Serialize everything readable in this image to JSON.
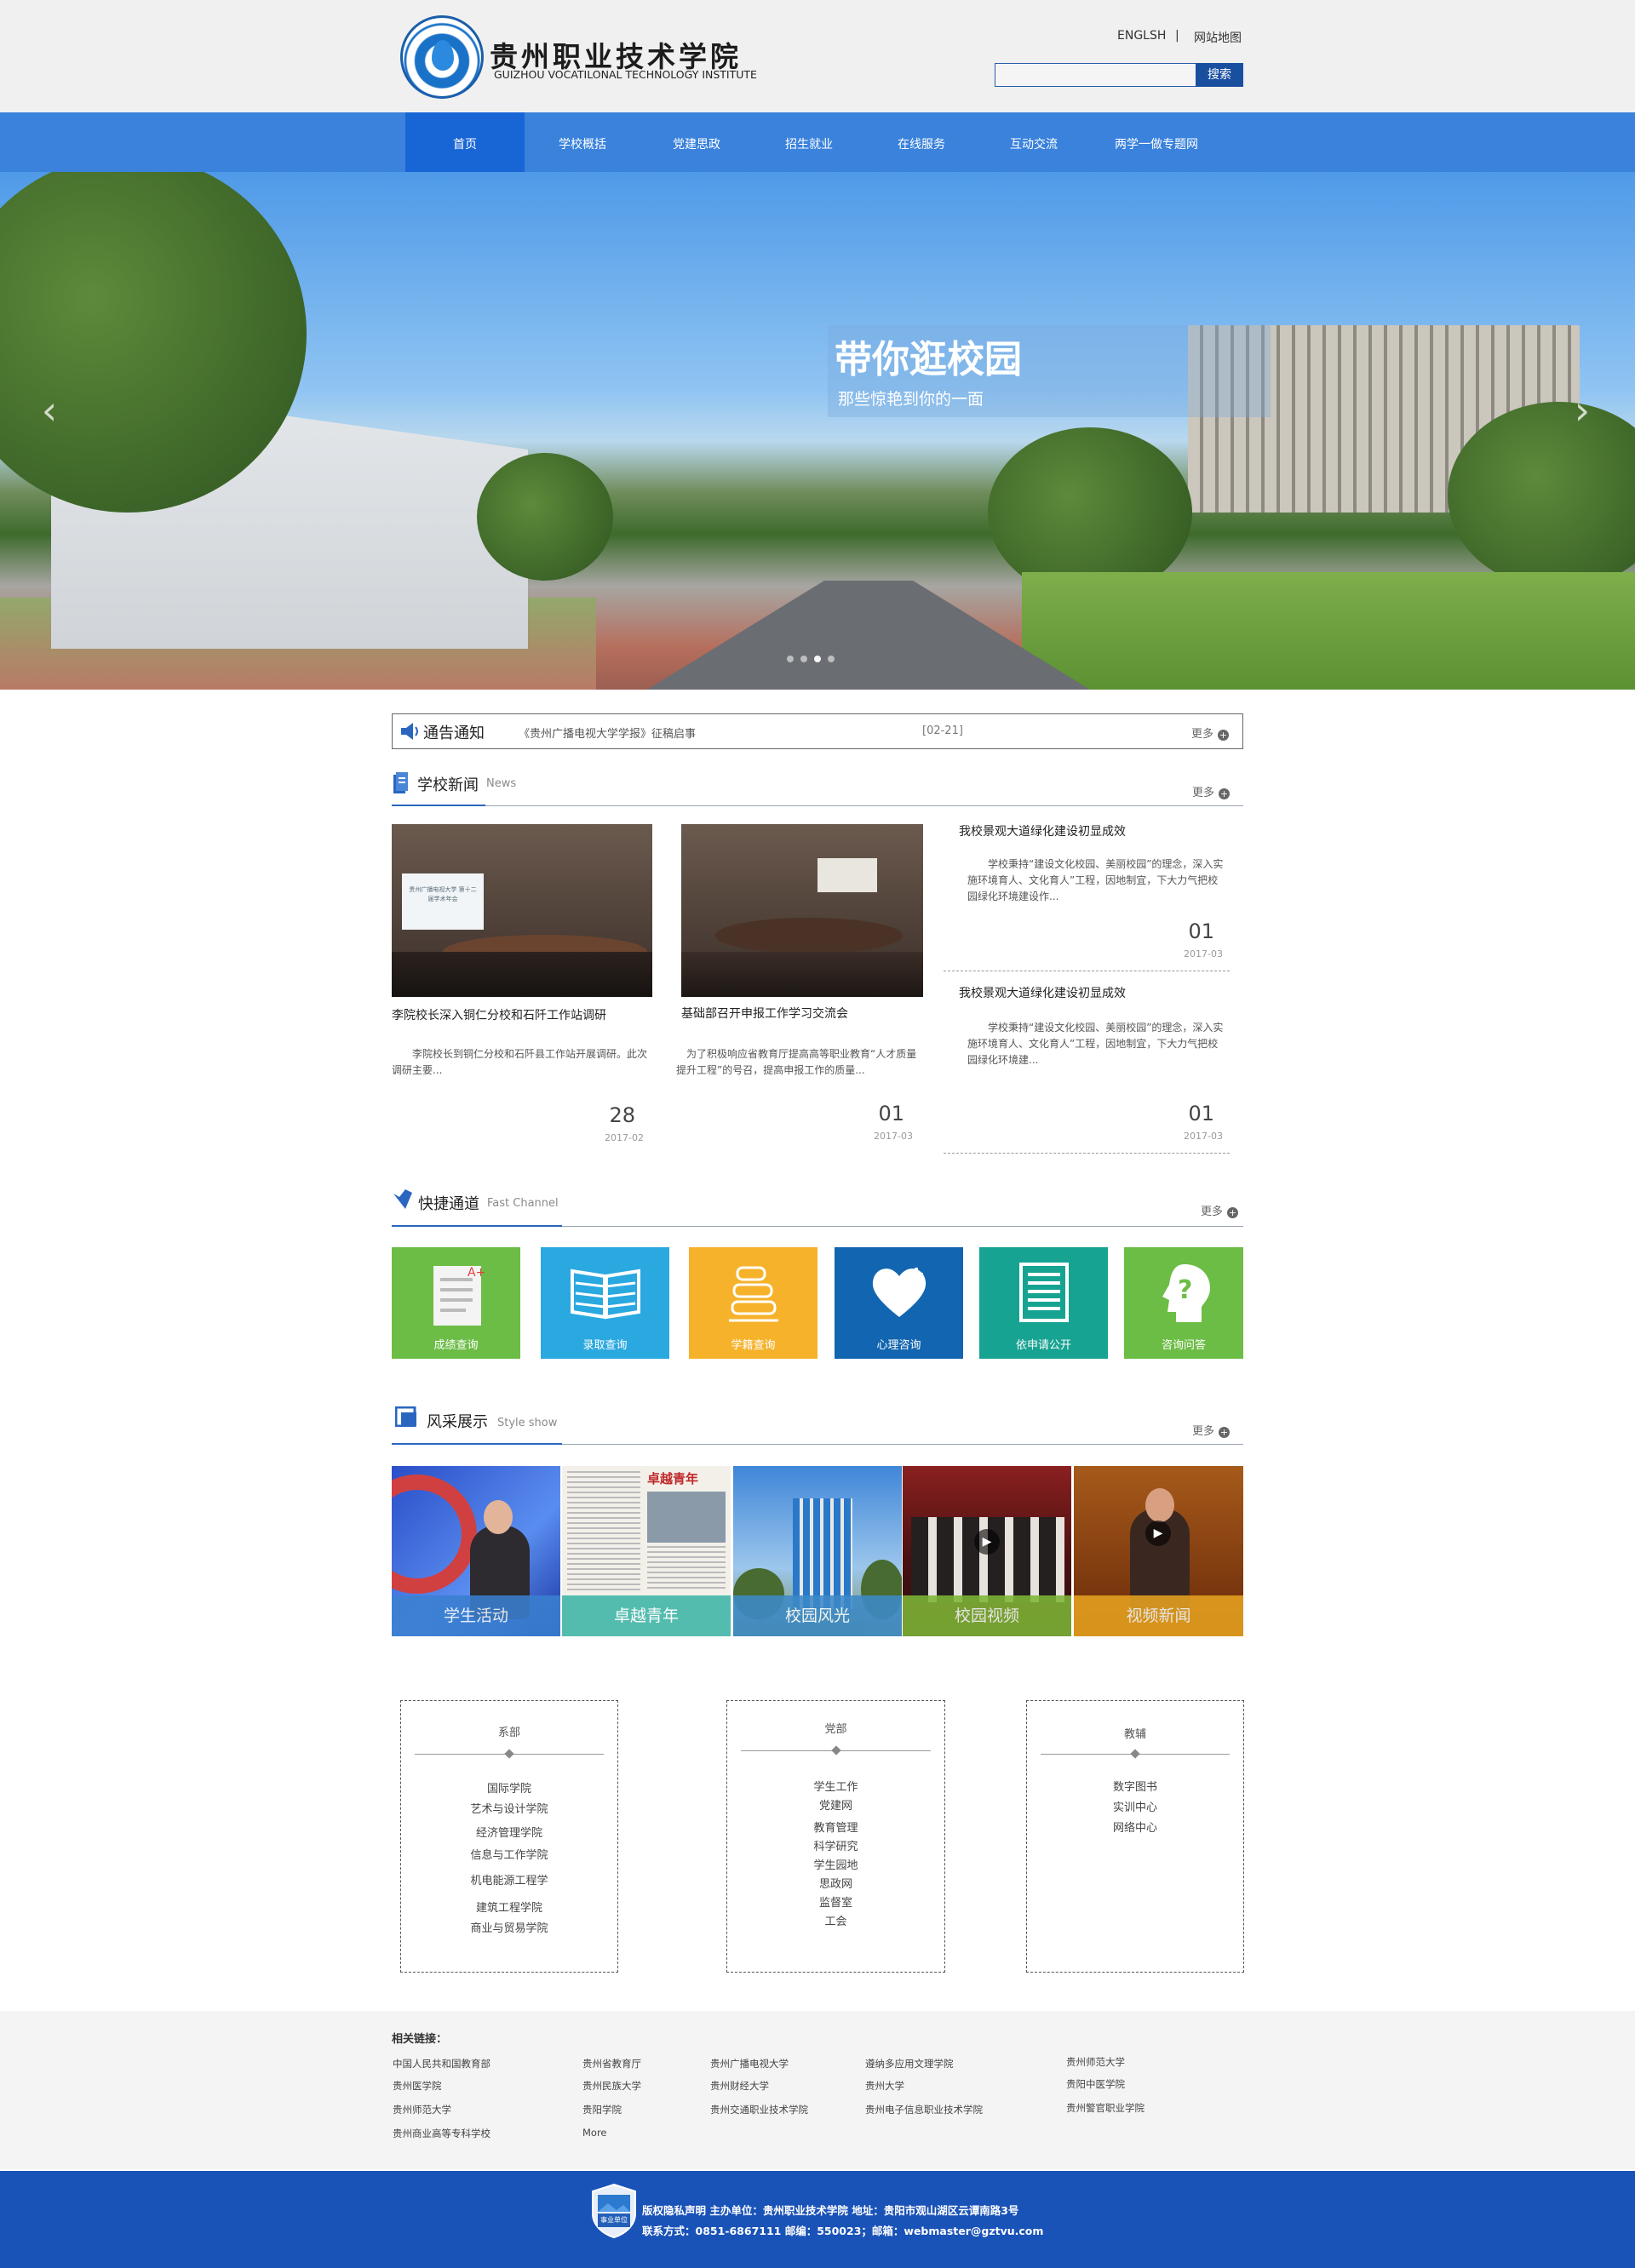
{
  "header": {
    "school_name": "贵州职业技术学院",
    "school_name_en": "GUIZHOU VOCATILONAL TECHNOLOGY INSTITUTE",
    "link_english": "ENGLSH",
    "separator": "|",
    "link_sitemap": "网站地图",
    "search_placeholder": "",
    "search_button": "搜索"
  },
  "nav": {
    "items": [
      "首页",
      "学校概括",
      "党建思政",
      "招生就业",
      "在线服务",
      "互动交流",
      "两学一做专题网"
    ],
    "active_index": 0
  },
  "banner": {
    "title": "带你逛校园",
    "subtitle": "那些惊艳到你的一面",
    "slide_count": 4,
    "active_slide": 2
  },
  "notice": {
    "heading": "通告通知",
    "item_title": "《贵州广播电视大学学报》征稿启事",
    "item_date": "[02-21]",
    "more": "更多"
  },
  "news": {
    "heading": "学校新闻",
    "heading_en": "News",
    "more": "更多",
    "featured": [
      {
        "title": "李院校长深入铜仁分校和石阡工作站调研",
        "summary": "李院校长到铜仁分校和石阡县工作站开展调研。此次调研主要...",
        "day": "28",
        "date": "2017-02",
        "image_screen_text": "贵州广播电视大学 第十二届学术年会"
      },
      {
        "title": "基础部召开申报工作学习交流会",
        "summary": "为了积极响应省教育厅提高高等职业教育“人才质量提升工程”的号召，提高申报工作的质量...",
        "day": "01",
        "date": "2017-03"
      }
    ],
    "side": [
      {
        "title": "我校景观大道绿化建设初显成效",
        "summary": "学校秉持“建设文化校园、美丽校园”的理念，深入实施环境育人、文化育人”工程，因地制宜，下大力气把校园绿化环境建设作...",
        "day": "01",
        "date": "2017-03"
      },
      {
        "title": "我校景观大道绿化建设初显成效",
        "summary": "学校秉持“建设文化校园、美丽校园”的理念，深入实施环境育人、文化育人”工程，因地制宜，下大力气把校园绿化环境建...",
        "day": "01",
        "date": "2017-03"
      }
    ]
  },
  "quick": {
    "heading": "快捷通道",
    "heading_en": "Fast Channel",
    "more": "更多",
    "tiles": [
      {
        "label": "成绩查询",
        "color": "#6cbd45",
        "icon": "report-card-icon"
      },
      {
        "label": "录取查询",
        "color": "#2aa8e0",
        "icon": "book-icon"
      },
      {
        "label": "学籍查询",
        "color": "#f6b22a",
        "icon": "stacked-records-icon"
      },
      {
        "label": "心理咨询",
        "color": "#1265b0",
        "icon": "heart-plus-icon"
      },
      {
        "label": "依申请公开",
        "color": "#17a392",
        "icon": "document-list-icon"
      },
      {
        "label": "咨询问答",
        "color": "#6cbd45",
        "icon": "question-head-icon"
      }
    ]
  },
  "show": {
    "heading": "风采展示",
    "heading_en": "Style show",
    "more": "更多",
    "items": [
      {
        "label": "学生活动",
        "caption_color": "#3a7fd0"
      },
      {
        "label": "卓越青年",
        "caption_color": "#3fb5a8"
      },
      {
        "label": "校园风光",
        "caption_color": "#3d8ac8"
      },
      {
        "label": "校园视频",
        "caption_color": "#7fb636"
      },
      {
        "label": "视频新闻",
        "caption_color": "#e6a21f"
      }
    ],
    "newspaper_masthead": "卓越青年"
  },
  "departments": [
    {
      "heading": "系部",
      "items": [
        "国际学院",
        "艺术与设计学院",
        "经济管理学院",
        "信息与工作学院",
        "机电能源工程学",
        "建筑工程学院",
        "商业与贸易学院"
      ]
    },
    {
      "heading": "党部",
      "items": [
        "学生工作",
        "党建网",
        "教育管理",
        "科学研究",
        "学生园地",
        "思政网",
        "监督室",
        "工会"
      ]
    },
    {
      "heading": "教辅",
      "items": [
        "数字图书",
        "实训中心",
        "网络中心"
      ]
    }
  ],
  "links": {
    "heading": "相关链接：",
    "columns": [
      [
        "中国人民共和国教育部",
        "贵州医学院",
        "贵州师范大学",
        "贵州商业高等专科学校"
      ],
      [
        "贵州省教育厅",
        "贵州民族大学",
        "贵阳学院",
        "More"
      ],
      [
        "贵州广播电视大学",
        "贵州财经大学",
        "贵州交通职业技术学院"
      ],
      [
        "遵纳多应用文理学院",
        "贵州大学",
        "贵州电子信息职业技术学院"
      ],
      [
        "贵州师范大学",
        "贵阳中医学院",
        "贵州警官职业学院"
      ]
    ]
  },
  "footer": {
    "badge_text": "事业单位",
    "line1": "版权隐私声明  主办单位：贵州职业技术学院  地址：贵阳市观山湖区云谭南路3号",
    "line2": "联系方式：0851-6867111  邮编：550023；邮箱：webmaster@gztvu.com"
  }
}
